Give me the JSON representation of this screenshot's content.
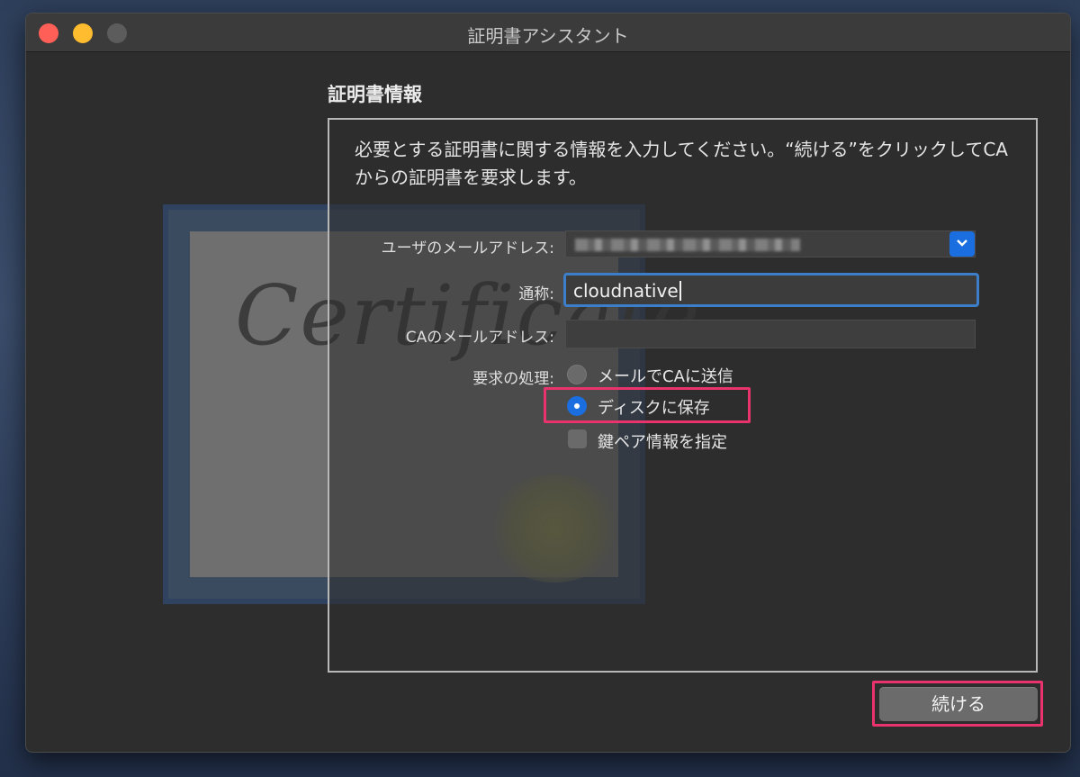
{
  "window": {
    "title": "証明書アシスタント"
  },
  "certificate_graphic": {
    "script_text": "Certificate"
  },
  "section": {
    "title": "証明書情報"
  },
  "intro": {
    "text": "必要とする証明書に関する情報を入力してください。“続ける”をクリックしてCAからの証明書を要求します。"
  },
  "form": {
    "email_label": "ユーザのメールアドレス:",
    "email_value": "",
    "name_label": "通称:",
    "name_value": "cloudnative",
    "ca_email_label": "CAのメールアドレス:",
    "ca_email_value": "",
    "request_label": "要求の処理:",
    "options": [
      {
        "label": "メールでCAに送信",
        "selected": false
      },
      {
        "label": "ディスクに保存",
        "selected": true
      }
    ],
    "keypair_label": "鍵ペア情報を指定",
    "keypair_checked": false
  },
  "buttons": {
    "continue_label": "続ける"
  },
  "colors": {
    "accent": "#1a6ee0",
    "highlight": "#e8336d"
  }
}
